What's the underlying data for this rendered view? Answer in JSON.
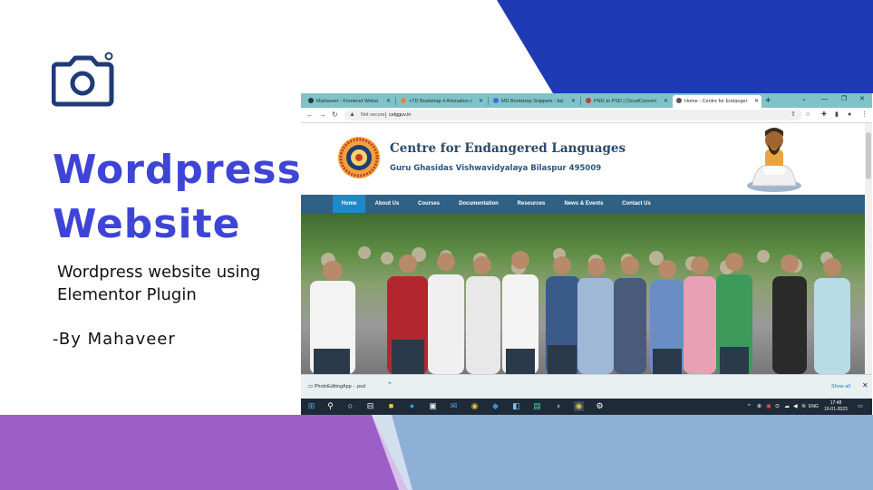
{
  "slide": {
    "title_line1": "Wordpress",
    "title_line2": "Website",
    "subtitle_line1": "Wordpress website using",
    "subtitle_line2": "Elementor Plugin",
    "byline": "-By Mahaveer",
    "colors": {
      "accent_blue": "#1f3bb3",
      "title": "#3e44d6",
      "purple": "#9b5fc7",
      "light_blue": "#8fb0d6",
      "camera": "#1f3b78"
    },
    "camera_icon": "camera-icon"
  },
  "browser": {
    "tabs": [
      {
        "label": "Mahaveer - Frontend Websi",
        "favicon_color": "#333333",
        "active": false
      },
      {
        "label": "+TD Bootstrap 4 Animation c",
        "favicon_color": "#e8833a",
        "active": false
      },
      {
        "label": "MD Bootstrap Snippets - bsi",
        "favicon_color": "#3a6ee8",
        "active": false
      },
      {
        "label": "PNG to PSD | CloudConvert",
        "favicon_color": "#c23b3b",
        "active": false
      },
      {
        "label": "Home - Centre for Endanger",
        "favicon_color": "#555555",
        "active": true
      }
    ],
    "new_tab": "+",
    "address": {
      "security": "Not secure",
      "url": "celgguv.in"
    }
  },
  "site": {
    "title": "Centre for Endangered Languages",
    "subtitle": "Guru Ghasidas Vishwavidyalaya Bilaspur 495009",
    "nav": [
      "Home",
      "About Us",
      "Courses",
      "Documentation",
      "Resources",
      "News & Events",
      "Contact Us"
    ],
    "active_nav": "Home",
    "colors": {
      "nav_bg": "#2f6186",
      "nav_active": "#1f88c9",
      "title": "#2a4a6a"
    }
  },
  "downloads": {
    "file": "PhotoEditingApp - .psd",
    "show_all": "Show all"
  },
  "taskbar": {
    "lang": "ENG",
    "time": "17:48",
    "date": "16-01-2023"
  }
}
